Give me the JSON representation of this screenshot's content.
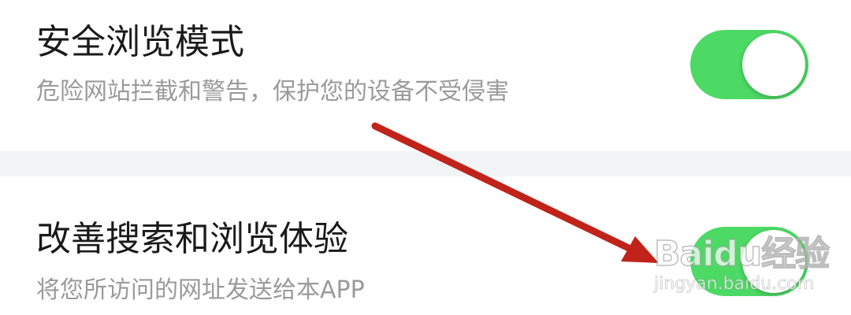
{
  "settings": [
    {
      "title": "安全浏览模式",
      "description": "危险网站拦截和警告，保护您的设备不受侵害",
      "enabled": true
    },
    {
      "title": "改善搜索和浏览体验",
      "description": "将您所访问的网址发送给本APP",
      "enabled": true
    }
  ],
  "colors": {
    "toggle_on": "#4cd964",
    "arrow": "#c0231a",
    "divider": "#f2f3f5"
  },
  "watermark": {
    "brand": "Baidu经验",
    "url": "jingyan.baidu.com"
  }
}
